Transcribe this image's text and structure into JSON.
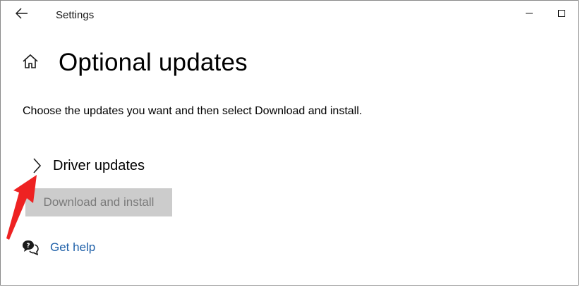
{
  "window": {
    "app_title": "Settings"
  },
  "page": {
    "title": "Optional updates",
    "description": "Choose the updates you want and then select Download and install."
  },
  "driver_updates": {
    "label": "Driver updates"
  },
  "download_button": {
    "label": "Download and install"
  },
  "help": {
    "label": "Get help"
  },
  "colors": {
    "link": "#1d5fa8",
    "button_disabled_bg": "#cccccc",
    "button_disabled_text": "#7a7a7a",
    "annotation_arrow": "#ee2222"
  }
}
